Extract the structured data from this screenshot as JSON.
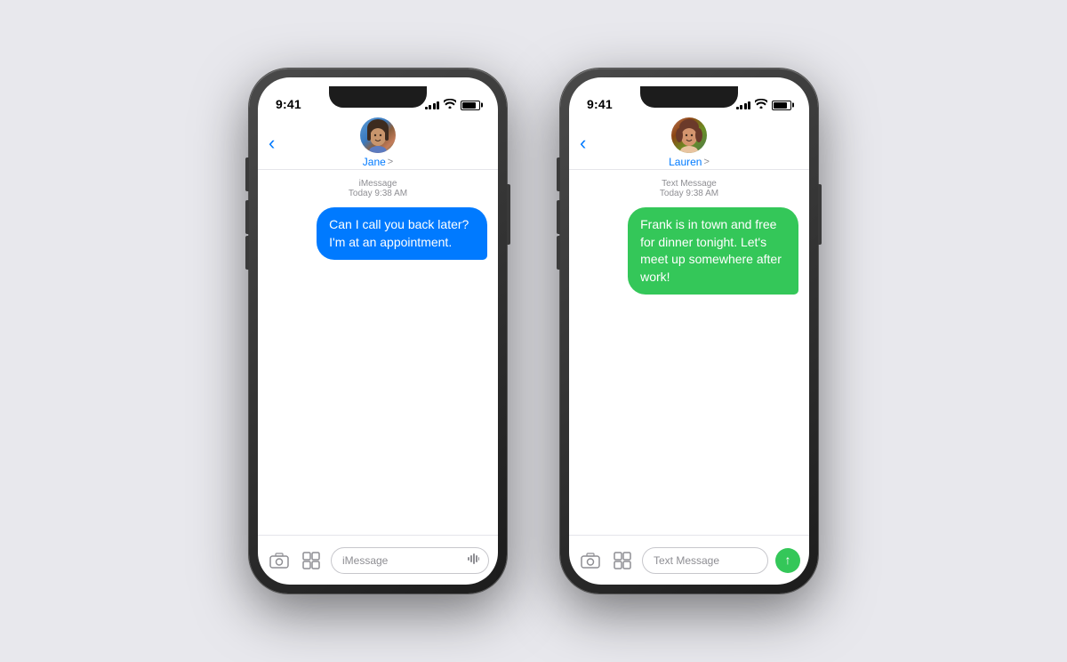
{
  "background": "#e8e8ed",
  "phones": [
    {
      "id": "phone-left",
      "statusBar": {
        "time": "9:41",
        "signalBars": [
          3,
          5,
          7,
          9,
          11
        ],
        "wifi": true,
        "battery": true
      },
      "contact": {
        "name": "Jane",
        "avatarType": "jane"
      },
      "messageTypeLabel": "iMessage",
      "messageDateLabel": "Today 9:38 AM",
      "messageBubble": {
        "text": "Can I call you back later? I'm at an appointment.",
        "color": "blue"
      },
      "inputPlaceholder": "iMessage",
      "showSendButton": false,
      "inputType": "imessage"
    },
    {
      "id": "phone-right",
      "statusBar": {
        "time": "9:41",
        "signalBars": [
          3,
          5,
          7,
          9,
          11
        ],
        "wifi": true,
        "battery": true
      },
      "contact": {
        "name": "Lauren",
        "avatarType": "lauren"
      },
      "messageTypeLabel": "Text Message",
      "messageDateLabel": "Today 9:38 AM",
      "messageBubble": {
        "text": "Frank is in town and free for dinner tonight. Let's meet up somewhere after work!",
        "color": "green"
      },
      "inputPlaceholder": "Text Message",
      "showSendButton": true,
      "inputType": "sms"
    }
  ],
  "labels": {
    "back": "‹",
    "chevron": ">",
    "camera": "⊙",
    "appStore": "⊞",
    "audioWave": "≈",
    "sendArrow": "↑"
  }
}
